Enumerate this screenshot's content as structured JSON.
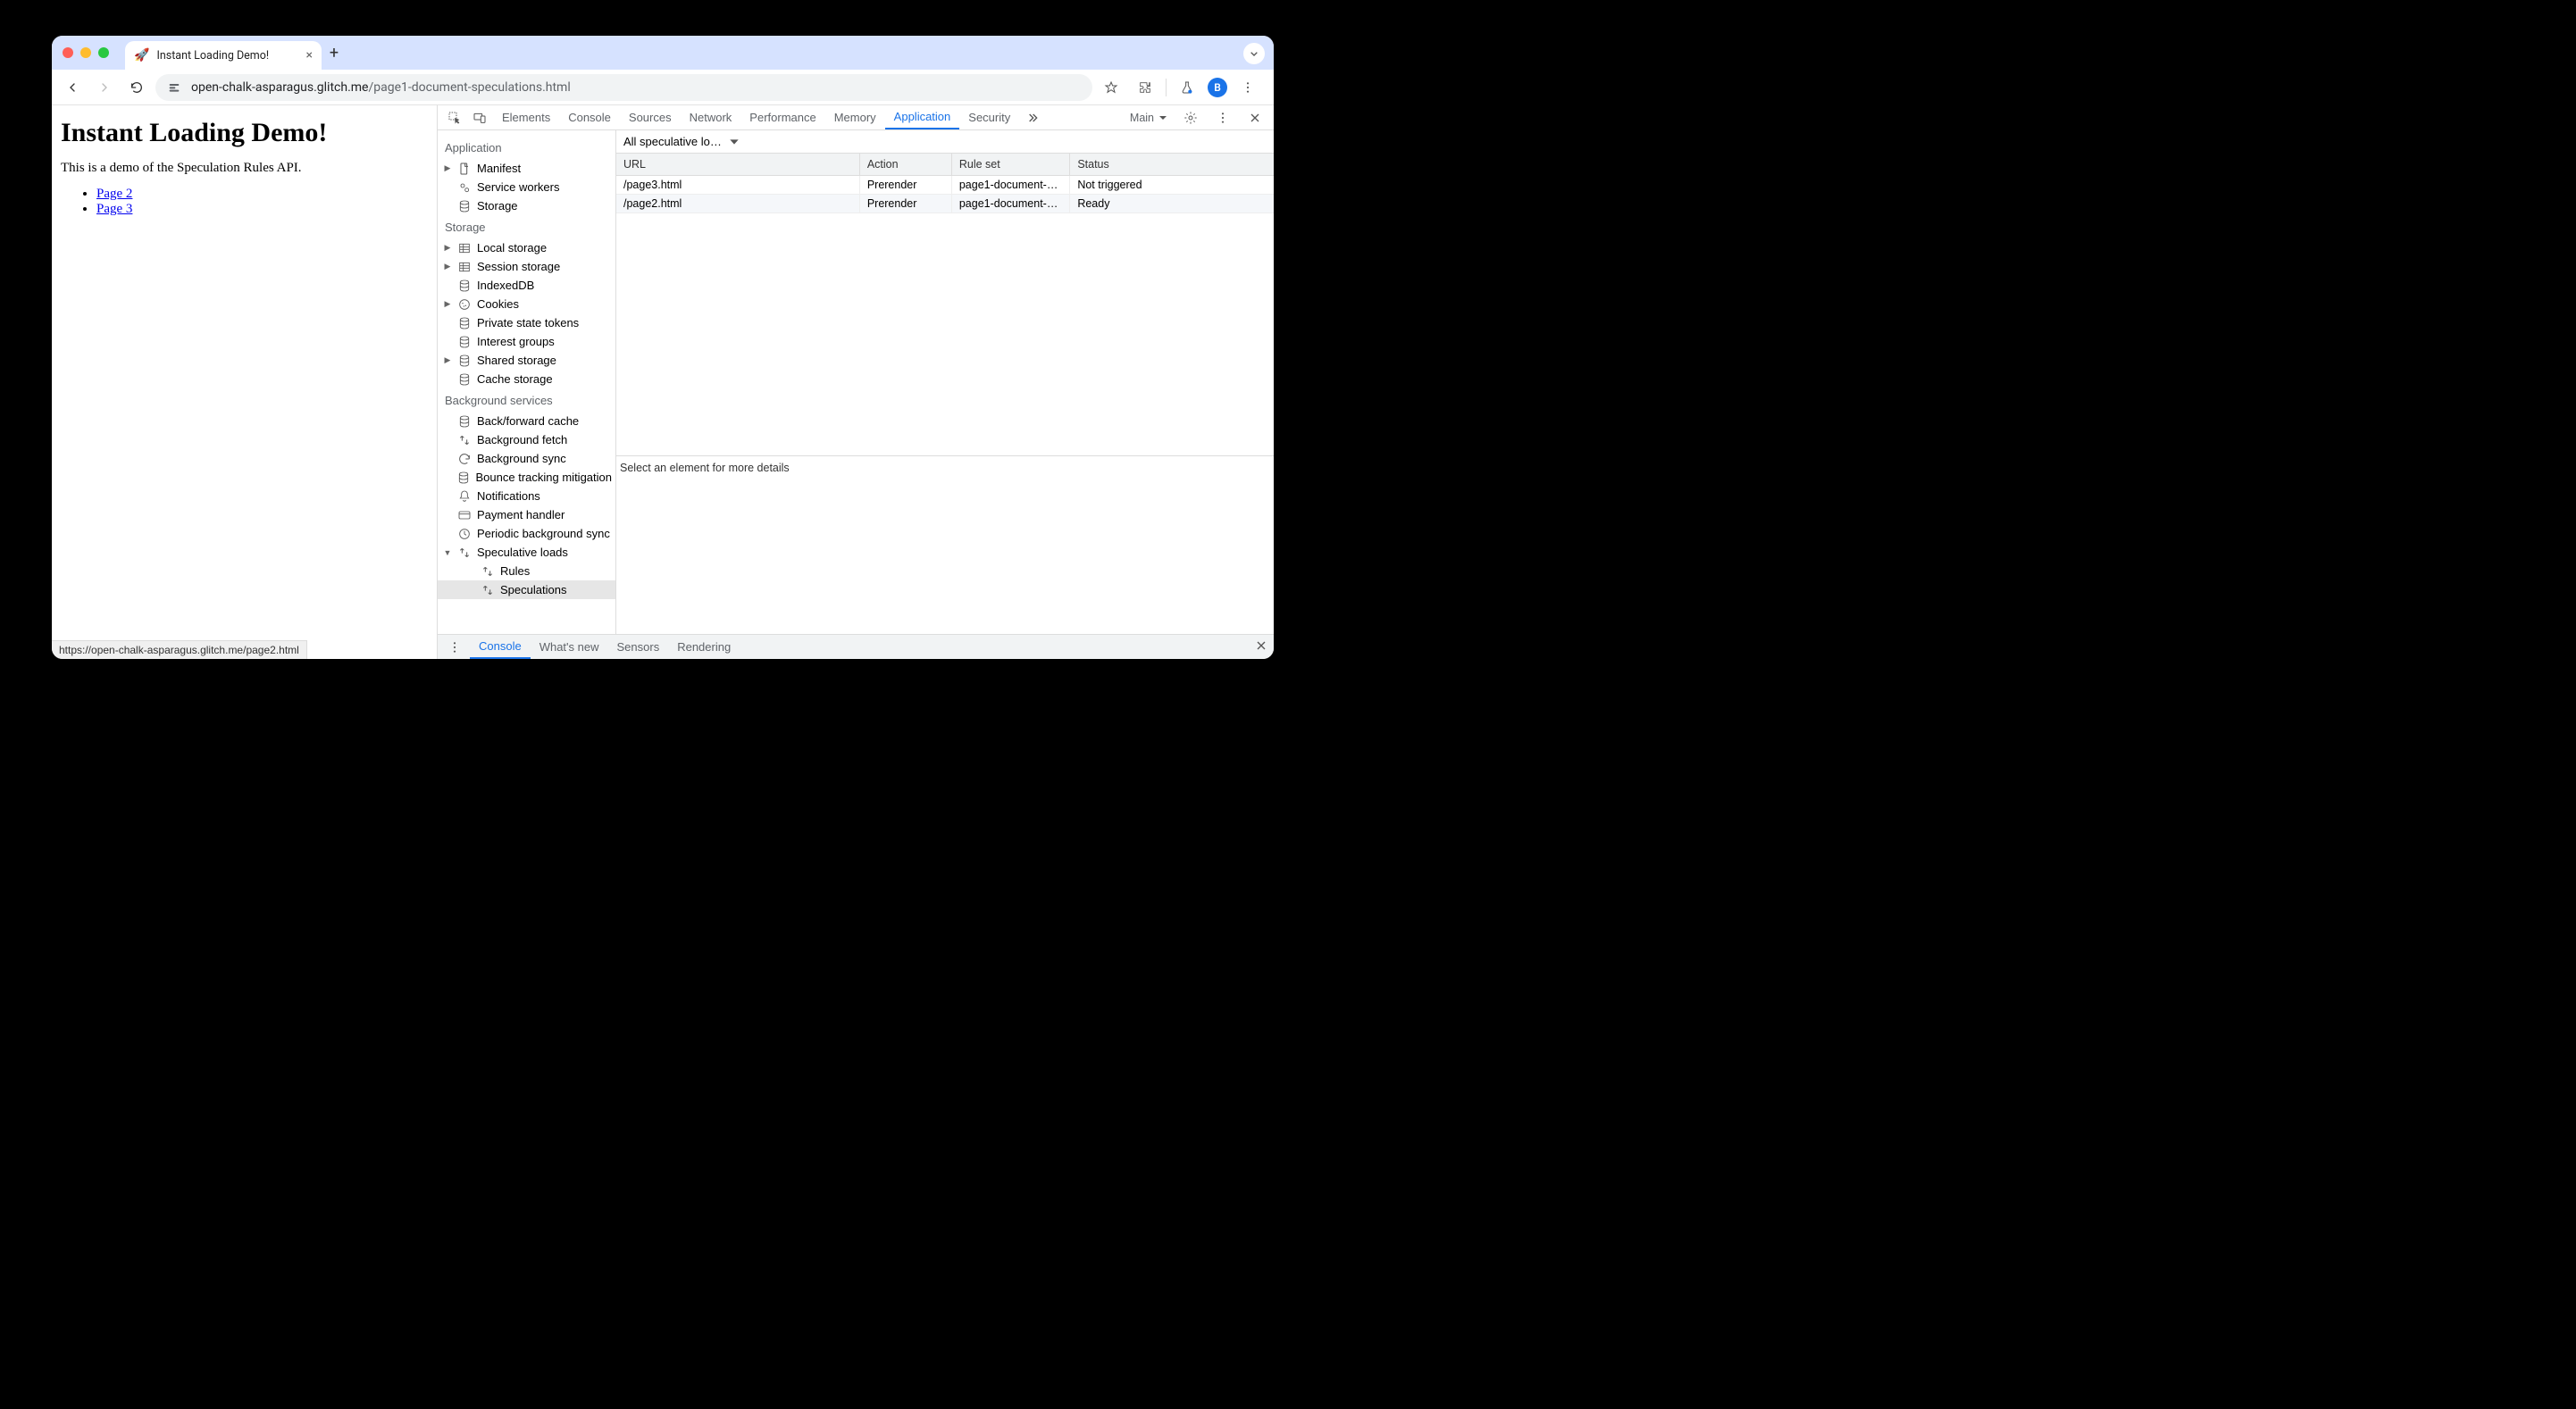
{
  "browser": {
    "tab": {
      "title": "Instant Loading Demo!",
      "favicon": "🚀"
    },
    "url_domain": "open-chalk-asparagus.glitch.me",
    "url_path": "/page1-document-speculations.html",
    "avatar_initial": "B",
    "status_bar": "https://open-chalk-asparagus.glitch.me/page2.html"
  },
  "page": {
    "heading": "Instant Loading Demo!",
    "intro": "This is a demo of the Speculation Rules API.",
    "links": [
      "Page 2",
      "Page 3"
    ]
  },
  "devtools": {
    "tabs": [
      "Elements",
      "Console",
      "Sources",
      "Network",
      "Performance",
      "Memory",
      "Application",
      "Security"
    ],
    "active_tab": "Application",
    "target_label": "Main",
    "sidebar": {
      "sections": [
        {
          "title": "Application",
          "items": [
            {
              "label": "Manifest",
              "icon": "file",
              "caret": "right"
            },
            {
              "label": "Service workers",
              "icon": "gears"
            },
            {
              "label": "Storage",
              "icon": "db"
            }
          ]
        },
        {
          "title": "Storage",
          "items": [
            {
              "label": "Local storage",
              "icon": "table",
              "caret": "right"
            },
            {
              "label": "Session storage",
              "icon": "table",
              "caret": "right"
            },
            {
              "label": "IndexedDB",
              "icon": "db"
            },
            {
              "label": "Cookies",
              "icon": "cookie",
              "caret": "right"
            },
            {
              "label": "Private state tokens",
              "icon": "db"
            },
            {
              "label": "Interest groups",
              "icon": "db"
            },
            {
              "label": "Shared storage",
              "icon": "db",
              "caret": "right"
            },
            {
              "label": "Cache storage",
              "icon": "db"
            }
          ]
        },
        {
          "title": "Background services",
          "items": [
            {
              "label": "Back/forward cache",
              "icon": "db"
            },
            {
              "label": "Background fetch",
              "icon": "arrows"
            },
            {
              "label": "Background sync",
              "icon": "sync"
            },
            {
              "label": "Bounce tracking mitigation",
              "icon": "db"
            },
            {
              "label": "Notifications",
              "icon": "bell"
            },
            {
              "label": "Payment handler",
              "icon": "card"
            },
            {
              "label": "Periodic background sync",
              "icon": "clock"
            },
            {
              "label": "Speculative loads",
              "icon": "arrows",
              "caret": "down",
              "children": [
                {
                  "label": "Rules",
                  "icon": "arrows"
                },
                {
                  "label": "Speculations",
                  "icon": "arrows",
                  "selected": true
                }
              ]
            }
          ]
        }
      ]
    },
    "filter": "All speculative loa…",
    "table": {
      "columns": [
        "URL",
        "Action",
        "Rule set",
        "Status"
      ],
      "widths": [
        "37%",
        "14%",
        "18%",
        "31%"
      ],
      "rows": [
        {
          "url": "/page3.html",
          "action": "Prerender",
          "ruleset": "page1-document-…",
          "status": "Not triggered"
        },
        {
          "url": "/page2.html",
          "action": "Prerender",
          "ruleset": "page1-document-…",
          "status": "Ready"
        }
      ]
    },
    "detail_hint": "Select an element for more details",
    "drawer": {
      "tabs": [
        "Console",
        "What's new",
        "Sensors",
        "Rendering"
      ],
      "active": "Console"
    }
  }
}
